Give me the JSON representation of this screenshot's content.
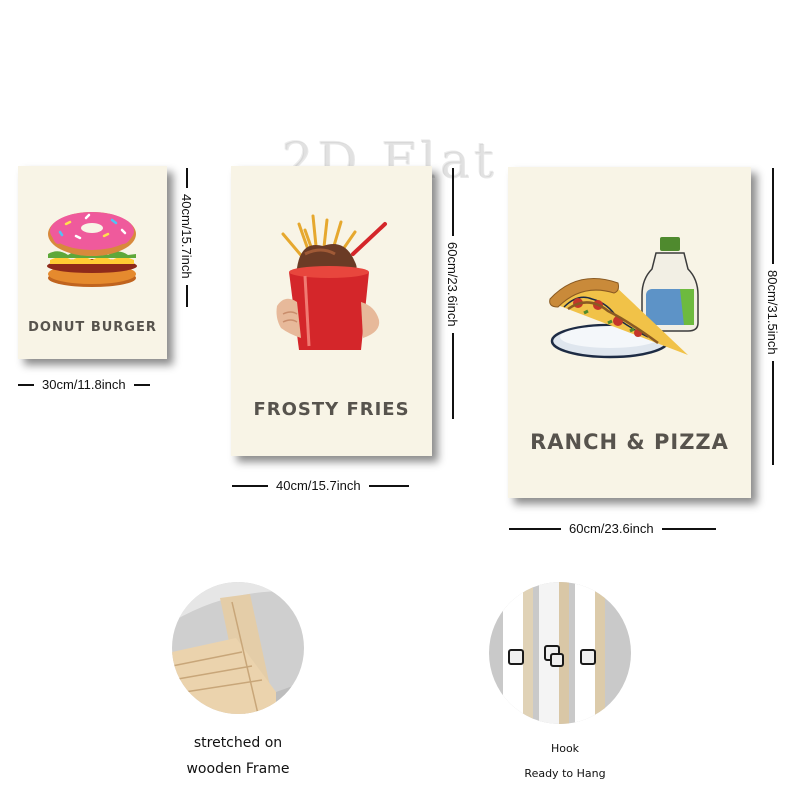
{
  "watermark": "2D Flat",
  "posters": [
    {
      "title": "DONUT BURGER",
      "illustration": "donut-burger-illustration",
      "width_label": "30cm/11.8inch",
      "height_label": "40cm/15.7inch"
    },
    {
      "title": "FROSTY FRIES",
      "illustration": "frosty-fries-illustration",
      "width_label": "40cm/15.7inch",
      "height_label": "60cm/23.6inch"
    },
    {
      "title": "RANCH & PIZZA",
      "illustration": "ranch-pizza-illustration",
      "width_label": "60cm/23.6inch",
      "height_label": "80cm/31.5inch"
    }
  ],
  "details": [
    {
      "photo": "wooden-frame-photo",
      "caption_lines": [
        "stretched on",
        "wooden Frame"
      ]
    },
    {
      "photo": "hook-photo",
      "caption_lines": [
        "Hook",
        "Ready to Hang"
      ]
    }
  ],
  "colors": {
    "poster_bg": "#f8f4e6",
    "title_text": "#57534d",
    "cup_red": "#d4262a",
    "donut_pink": "#ef5a9c"
  }
}
